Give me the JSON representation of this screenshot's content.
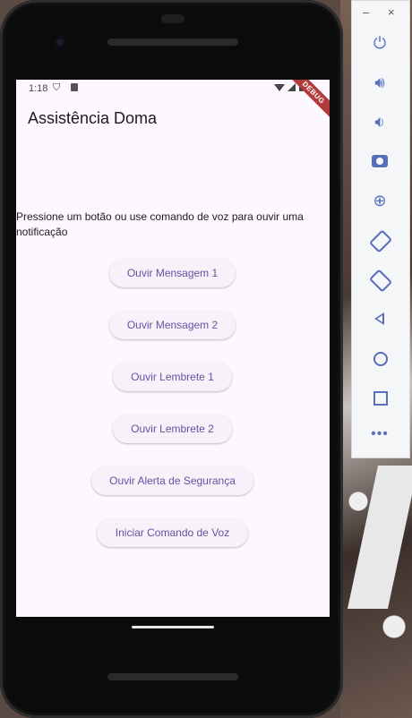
{
  "status_bar": {
    "time": "1:18"
  },
  "debug_banner": "DEBUG",
  "app": {
    "title": "Assistência Doma",
    "instruction": "Pressione um botão ou use comando de voz para ouvir uma notificação",
    "buttons": [
      {
        "label": "Ouvir Mensagem 1"
      },
      {
        "label": "Ouvir Mensagem 2"
      },
      {
        "label": "Ouvir Lembrete 1"
      },
      {
        "label": "Ouvir Lembrete 2"
      },
      {
        "label": "Ouvir Alerta de Segurança"
      },
      {
        "label": "Iniciar Comando de Voz"
      }
    ]
  },
  "emulator_toolbar": {
    "minimize": "–",
    "close": "×",
    "icons": [
      "power-icon",
      "volume-up-icon",
      "volume-down-icon",
      "camera-icon",
      "zoom-icon",
      "rotate-left-icon",
      "rotate-right-icon",
      "back-icon",
      "home-icon",
      "overview-icon",
      "more-icon"
    ]
  },
  "colors": {
    "accent": "#6750a4",
    "background": "#fdf7ff",
    "button_bg": "#f7f2fa"
  }
}
